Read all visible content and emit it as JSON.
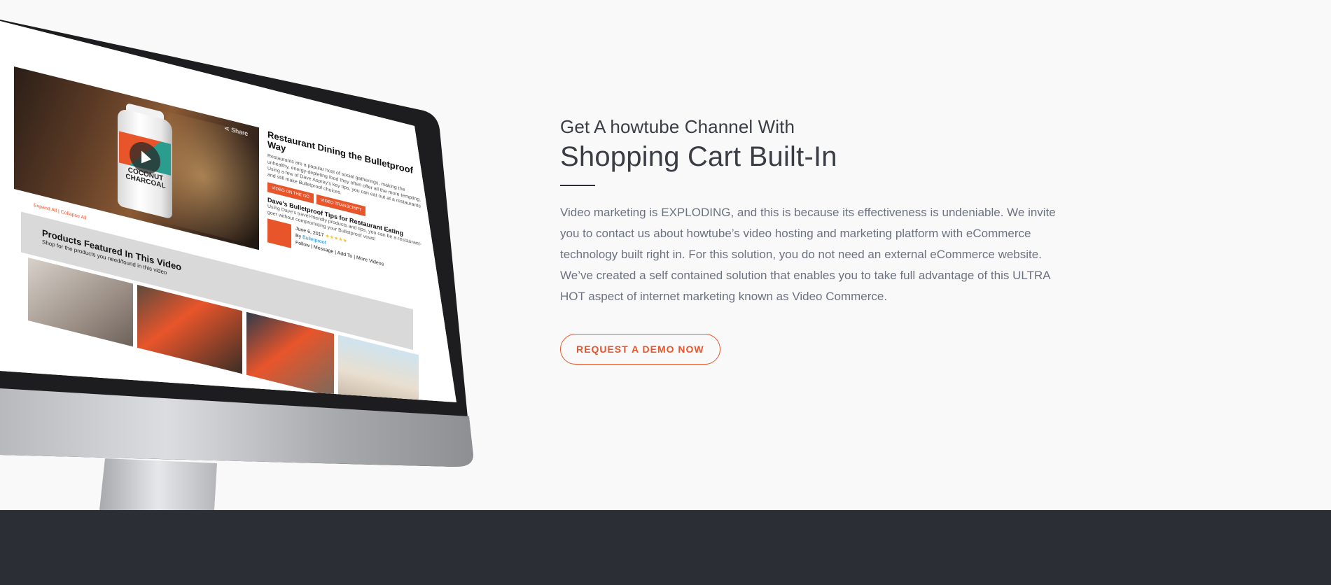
{
  "hero": {
    "eyebrow": "Get A howtube Channel With",
    "headline": "Shopping Cart Built-In",
    "body": "Video marketing is EXPLODING, and this is because its effectiveness is undeniable. We invite you to contact us about howtube’s video hosting and marketing platform with eCommerce technology built right in. For this solution, you do not need an external eCommerce website. We’ve created a self contained solution that enables you to take full advantage of this ULTRA HOT aspect of internet marketing known as Video Commerce.",
    "cta_label": "REQUEST A DEMO NOW"
  },
  "mockup": {
    "share_label": "Share",
    "bottle_text": "COCONUT CHARCOAL",
    "video_title": "Restaurant Dining the Bulletproof Way",
    "video_desc": "Restaurants are a popular host of social gatherings, making the unhealthy, energy-depleting food they often offer all the more tempting. Using a few of Dave Asprey's key tips, you can eat out at a restaurants and still make Bulletproof choices.",
    "btn_video_on_the_go": "VIDEO ON THE GO",
    "btn_video_transcript": "VIDEO TRANSCRIPT",
    "sub_title": "Dave's Bulletproof Tips for Restaurant Eating",
    "sub_desc": "Using Dave's travel-friendly products and tips, you can be a restaurant-goer without compromising your Bulletproof vows!",
    "date": "June 6, 2017",
    "stars": "★★★★★",
    "by_prefix": "By",
    "by_name": "Bulletproof",
    "actions": "Follow | Message | Add To | More Videos",
    "expand_links": "Expand All | Collapse All",
    "products_title": "Products Featured In This Video",
    "products_sub": "Shop for the products you need/found in this video"
  },
  "colors": {
    "accent": "#e8552b",
    "text_dark": "#3a3d44",
    "text_body": "#6d7280",
    "footer_band": "#2b2e35",
    "background": "#f9f9f9"
  }
}
